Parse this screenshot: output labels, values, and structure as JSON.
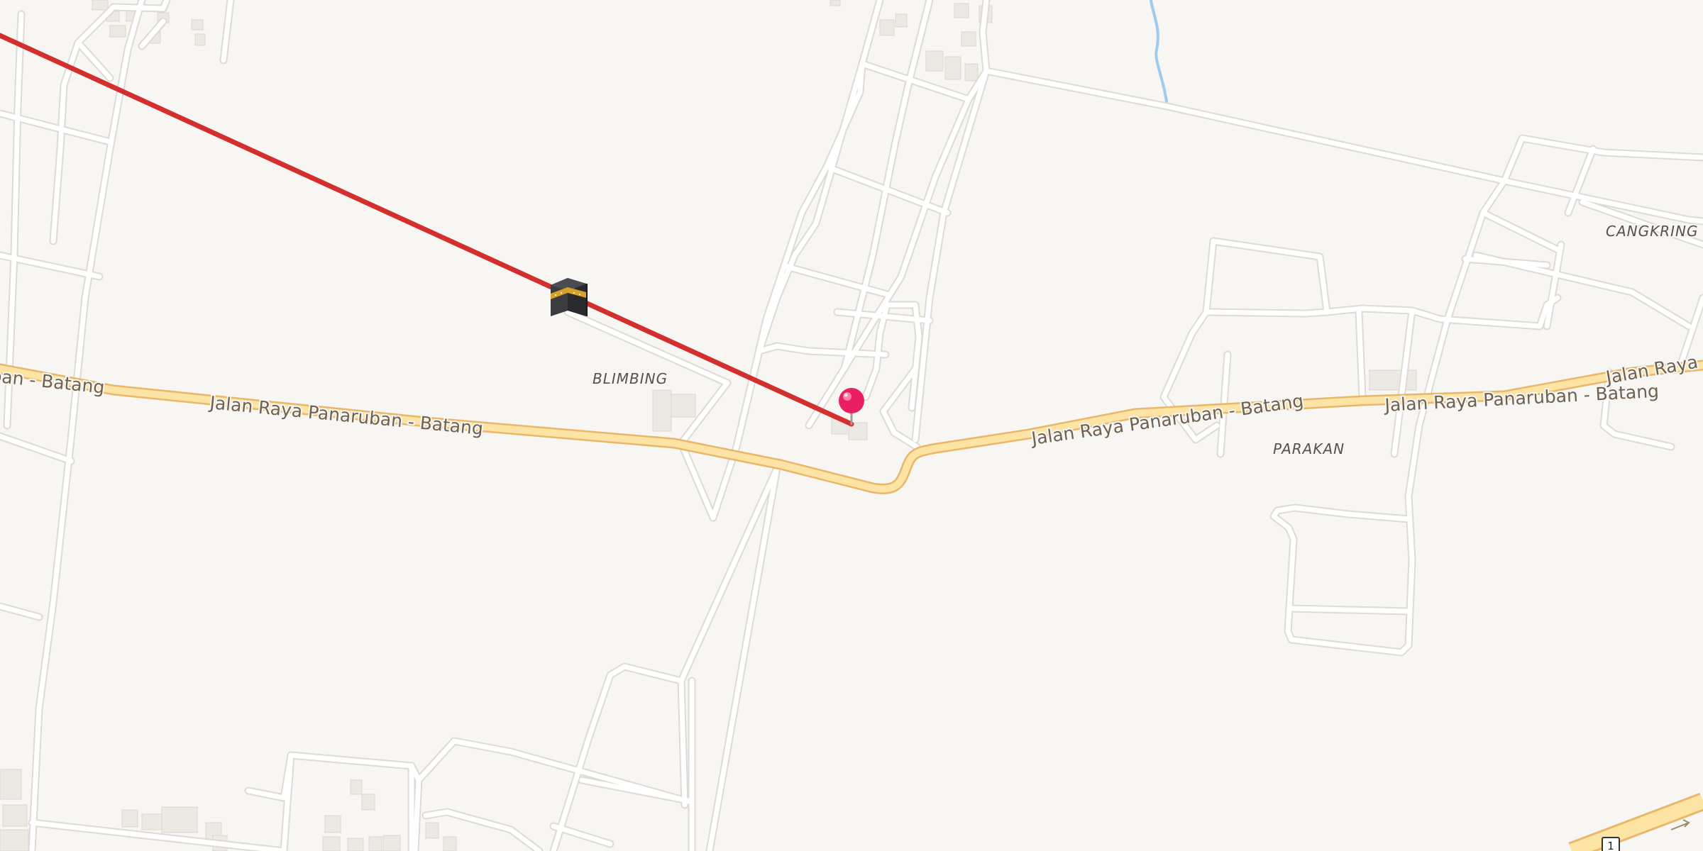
{
  "map": {
    "road_labels": [
      "Jalan Raya Panaruban - Batang",
      "Jalan Raya Panaruban - Batang",
      "Jalan Raya Panaruban - Batang",
      "Jalan Raya Panaruban - Batang"
    ],
    "road_label_partial": "ban - Batang",
    "places": [
      "BLIMBING",
      "PARAKAN",
      "CANGKRING"
    ],
    "route_shield": "1",
    "colors": {
      "background": "#f8f6f3",
      "main_road": "#fde3a4",
      "main_road_casing": "#e8b86a",
      "qibla_line": "#d32f2f",
      "pin": "#e91e63",
      "water": "#9ecbf0"
    },
    "icons": {
      "qibla_marker": "kaaba-icon",
      "location_pin": "red-map-pin-icon"
    }
  }
}
